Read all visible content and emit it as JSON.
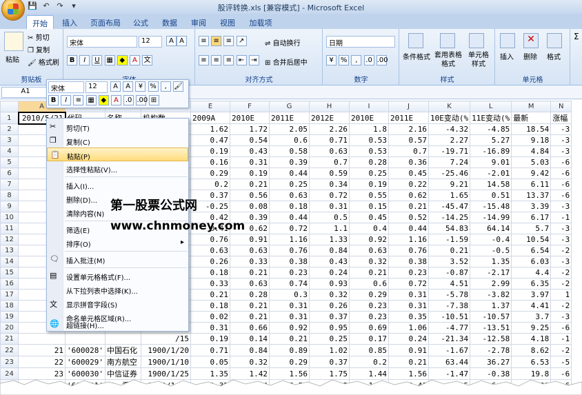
{
  "window": {
    "title": "股评转换.xls [兼容模式] - Microsoft Excel"
  },
  "tabs": [
    "开始",
    "插入",
    "页面布局",
    "公式",
    "数据",
    "审阅",
    "视图",
    "加载项"
  ],
  "ribbon": {
    "clipboard": {
      "paste": "粘贴",
      "cut": "剪切",
      "copy": "复制",
      "format_painter": "格式刷",
      "label": "剪贴板"
    },
    "font": {
      "name": "宋体",
      "size": "12",
      "label": "字体"
    },
    "alignment": {
      "wrap": "自动换行",
      "merge": "合并后居中",
      "label": "对齐方式"
    },
    "number": {
      "format": "日期",
      "label": "数字"
    },
    "styles": {
      "conditional": "条件格式",
      "table": "套用表格格式",
      "cell": "单元格样式",
      "label": "样式"
    },
    "cells": {
      "insert": "插入",
      "delete": "删除",
      "format": "格式",
      "label": "单元格"
    }
  },
  "formula_bar": {
    "name_box": "A1"
  },
  "mini_toolbar": {
    "font": "宋体",
    "size": "12"
  },
  "columns": [
    "A",
    "B",
    "C",
    "D",
    "E",
    "F",
    "G",
    "H",
    "I",
    "J",
    "K",
    "L",
    "M",
    "N"
  ],
  "header_row": [
    "2010/5/21",
    "代码",
    "名称",
    "机构数",
    "2009A",
    "2010E",
    "2011E",
    "2012E",
    "2010E",
    "2011E",
    "10E变动(%",
    "11E变动(%",
    "最新",
    "涨幅"
  ],
  "rows": [
    {
      "n": "2",
      "D": "2/2",
      "E": "1.62",
      "F": "1.72",
      "G": "2.05",
      "H": "2.26",
      "I": "1.8",
      "J": "2.16",
      "K": "-4.32",
      "L": "-4.85",
      "M": "18.54",
      "N": "-3"
    },
    {
      "n": "3",
      "D": "/11",
      "E": "0.47",
      "F": "0.54",
      "G": "0.6",
      "H": "0.71",
      "I": "0.53",
      "J": "0.57",
      "K": "2.27",
      "L": "5.27",
      "M": "9.18",
      "N": "-3"
    },
    {
      "n": "4",
      "D": "/17",
      "E": "0.19",
      "F": "0.43",
      "G": "0.58",
      "H": "0.63",
      "I": "0.53",
      "J": "0.7",
      "K": "-19.71",
      "L": "-16.89",
      "M": "4.84",
      "N": "-3"
    },
    {
      "n": "5",
      "D": "1/9",
      "E": "0.16",
      "F": "0.31",
      "G": "0.39",
      "H": "0.7",
      "I": "0.28",
      "J": "0.36",
      "K": "7.24",
      "L": "9.01",
      "M": "5.03",
      "N": "-6"
    },
    {
      "n": "6",
      "D": "1/5",
      "E": "0.29",
      "F": "0.19",
      "G": "0.44",
      "H": "0.59",
      "I": "0.25",
      "J": "0.45",
      "K": "-25.46",
      "L": "-2.01",
      "M": "9.42",
      "N": "-6"
    },
    {
      "n": "7",
      "D": "1/3",
      "E": "0.2",
      "F": "0.21",
      "G": "0.25",
      "H": "0.34",
      "I": "0.19",
      "J": "0.22",
      "K": "9.21",
      "L": "14.58",
      "M": "6.11",
      "N": "-6"
    },
    {
      "n": "8",
      "D": "/17",
      "E": "0.37",
      "F": "0.56",
      "G": "0.63",
      "H": "0.72",
      "I": "0.55",
      "J": "0.62",
      "K": "1.65",
      "L": "0.51",
      "M": "13.37",
      "N": "-6"
    },
    {
      "n": "9",
      "D": "/18",
      "E": "-0.25",
      "F": "0.08",
      "G": "0.18",
      "H": "0.31",
      "I": "0.15",
      "J": "0.21",
      "K": "-45.47",
      "L": "-15.48",
      "M": "3.39",
      "N": "-3"
    },
    {
      "n": "10",
      "D": "/19",
      "E": "0.42",
      "F": "0.39",
      "G": "0.44",
      "H": "0.5",
      "I": "0.45",
      "J": "0.52",
      "K": "-14.25",
      "L": "-14.99",
      "M": "6.17",
      "N": "-1"
    },
    {
      "n": "11",
      "D": "/20",
      "E": "0.41",
      "F": "0.62",
      "G": "0.72",
      "H": "1.1",
      "I": "0.4",
      "J": "0.44",
      "K": "54.83",
      "L": "64.14",
      "M": "5.7",
      "N": "-3"
    },
    {
      "n": "12",
      "D": "/21",
      "E": "0.76",
      "F": "0.91",
      "G": "1.16",
      "H": "1.33",
      "I": "0.92",
      "J": "1.16",
      "K": "-1.59",
      "L": "-0.4",
      "M": "10.54",
      "N": "-3"
    },
    {
      "n": "13",
      "D": "/29",
      "E": "0.63",
      "F": "0.63",
      "G": "0.76",
      "H": "0.84",
      "I": "0.63",
      "J": "0.76",
      "K": "0.21",
      "L": "-0.5",
      "M": "6.54",
      "N": "-2"
    },
    {
      "n": "14",
      "D": "/17",
      "E": "0.26",
      "F": "0.33",
      "G": "0.38",
      "H": "0.43",
      "I": "0.32",
      "J": "0.38",
      "K": "3.52",
      "L": "1.35",
      "M": "6.03",
      "N": "-3"
    },
    {
      "n": "15",
      "D": "/10",
      "E": "0.18",
      "F": "0.21",
      "G": "0.23",
      "H": "0.24",
      "I": "0.21",
      "J": "0.23",
      "K": "-0.87",
      "L": "-2.17",
      "M": "4.4",
      "N": "-2"
    },
    {
      "n": "16",
      "D": "/31",
      "E": "0.33",
      "F": "0.63",
      "G": "0.74",
      "H": "0.93",
      "I": "0.6",
      "J": "0.72",
      "K": "4.51",
      "L": "2.99",
      "M": "6.35",
      "N": "-2"
    },
    {
      "n": "17",
      "D": "1/2",
      "E": "0.21",
      "F": "0.28",
      "G": "0.3",
      "H": "0.32",
      "I": "0.29",
      "J": "0.31",
      "K": "-5.78",
      "L": "-3.82",
      "M": "3.97",
      "N": "1"
    },
    {
      "n": "18",
      "D": "1/6",
      "E": "0.18",
      "F": "0.21",
      "G": "0.31",
      "H": "0.26",
      "I": "0.23",
      "J": "0.31",
      "K": "-7.38",
      "L": "1.37",
      "M": "4.41",
      "N": "-2"
    },
    {
      "n": "19",
      "D": "1/12",
      "E": "0.02",
      "F": "0.21",
      "G": "0.31",
      "H": "0.37",
      "I": "0.23",
      "J": "0.35",
      "K": "-10.51",
      "L": "-10.57",
      "M": "3.7",
      "N": "-3"
    },
    {
      "n": "20",
      "D": "/19",
      "E": "0.31",
      "F": "0.66",
      "G": "0.92",
      "H": "0.95",
      "I": "0.69",
      "J": "1.06",
      "K": "-4.77",
      "L": "-13.51",
      "M": "9.25",
      "N": "-6"
    },
    {
      "n": "21",
      "D": "/15",
      "E": "0.19",
      "F": "0.14",
      "G": "0.21",
      "H": "0.25",
      "I": "0.17",
      "J": "0.24",
      "K": "-21.34",
      "L": "-12.58",
      "M": "4.18",
      "N": "-1"
    },
    {
      "n": "22",
      "A": "21",
      "B": "'600028'",
      "C": "中国石化",
      "D": "1900/1/20",
      "E": "0.71",
      "F": "0.84",
      "G": "0.89",
      "H": "1.02",
      "I": "0.85",
      "J": "0.91",
      "K": "-1.67",
      "L": "-2.78",
      "M": "8.62",
      "N": "-2"
    },
    {
      "n": "23",
      "A": "22",
      "B": "'600029'",
      "C": "南方航空",
      "D": "1900/1/10",
      "E": "0.05",
      "F": "0.32",
      "G": "0.29",
      "H": "0.37",
      "I": "0.2",
      "J": "0.21",
      "K": "63.44",
      "L": "36.27",
      "M": "6.53",
      "N": "-5"
    },
    {
      "n": "24",
      "A": "23",
      "B": "'600030'",
      "C": "中信证券",
      "D": "1900/1/25",
      "E": "1.35",
      "F": "1.42",
      "G": "1.56",
      "H": "1.75",
      "I": "1.44",
      "J": "1.56",
      "K": "-1.47",
      "L": "-0.38",
      "M": "19.8",
      "N": "-6"
    },
    {
      "n": "25",
      "A": "24",
      "B": "'600031'",
      "C": "三一重工",
      "D": "1900/1/17",
      "E": "1.32",
      "F": "2.04",
      "G": "2.57",
      "H": "3.18",
      "I": "1.88",
      "J": "2.41",
      "K": "8.15",
      "L": "6.95",
      "M": "27.09",
      "N": "-6"
    },
    {
      "n": "26",
      "A": "25",
      "B": "'600033'",
      "C": "福建高速",
      "D": "1900/1/4",
      "E": "0.45",
      "F": "0.4",
      "G": "0.41",
      "H": "0.35",
      "I": "",
      "J": "0.43",
      "K": "-5.56",
      "L": "-3.96",
      "M": "6.32",
      "N": "-3"
    }
  ],
  "context_menu": [
    "剪切(T)",
    "复制(C)",
    "粘贴(P)",
    "选择性粘贴(V)...",
    "插入(I)...",
    "删除(D)...",
    "清除内容(N)",
    "筛选(E)",
    "排序(O)",
    "插入批注(M)",
    "设置单元格格式(F)...",
    "从下拉列表中选择(K)...",
    "显示拼音字段(S)",
    "命名单元格区域(R)...",
    "超链接(H)..."
  ],
  "watermark": {
    "line1": "第一股票公式网",
    "line2": "www.chnmoney.com"
  }
}
